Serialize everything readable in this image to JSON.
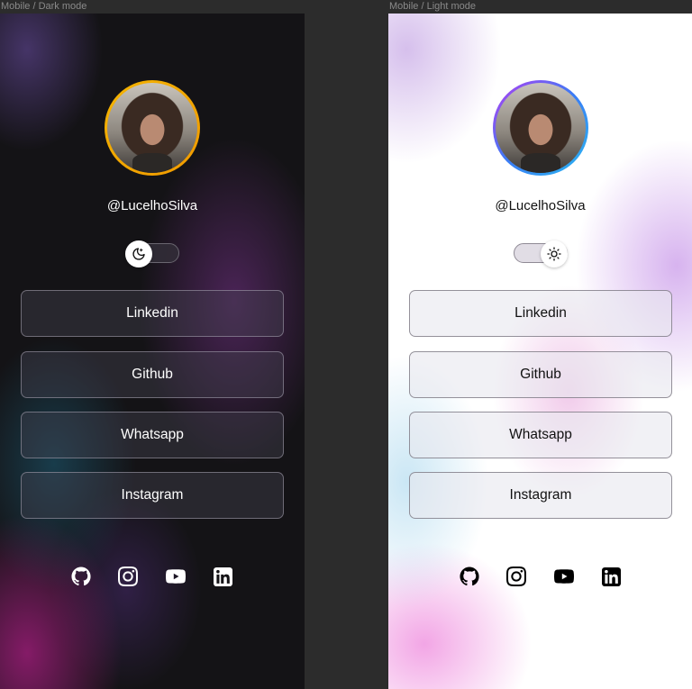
{
  "frames": {
    "dark": {
      "label": "Mobile / Dark mode",
      "theme_icon": "moon-icon"
    },
    "light": {
      "label": "Mobile / Light mode",
      "theme_icon": "sun-icon"
    }
  },
  "profile": {
    "username": "@LucelhoSilva",
    "avatar_ring_dark": "#f4b400",
    "avatar_ring_light": "#b53cf0"
  },
  "links": [
    {
      "label": "Linkedin"
    },
    {
      "label": "Github"
    },
    {
      "label": "Whatsapp"
    },
    {
      "label": "Instagram"
    }
  ],
  "social_icons": [
    "github-icon",
    "instagram-icon",
    "youtube-icon",
    "linkedin-icon"
  ],
  "colors": {
    "dark_bg": "#141316",
    "light_bg": "#ffffff",
    "dark_text": "#ffffff",
    "light_text": "#111111"
  }
}
